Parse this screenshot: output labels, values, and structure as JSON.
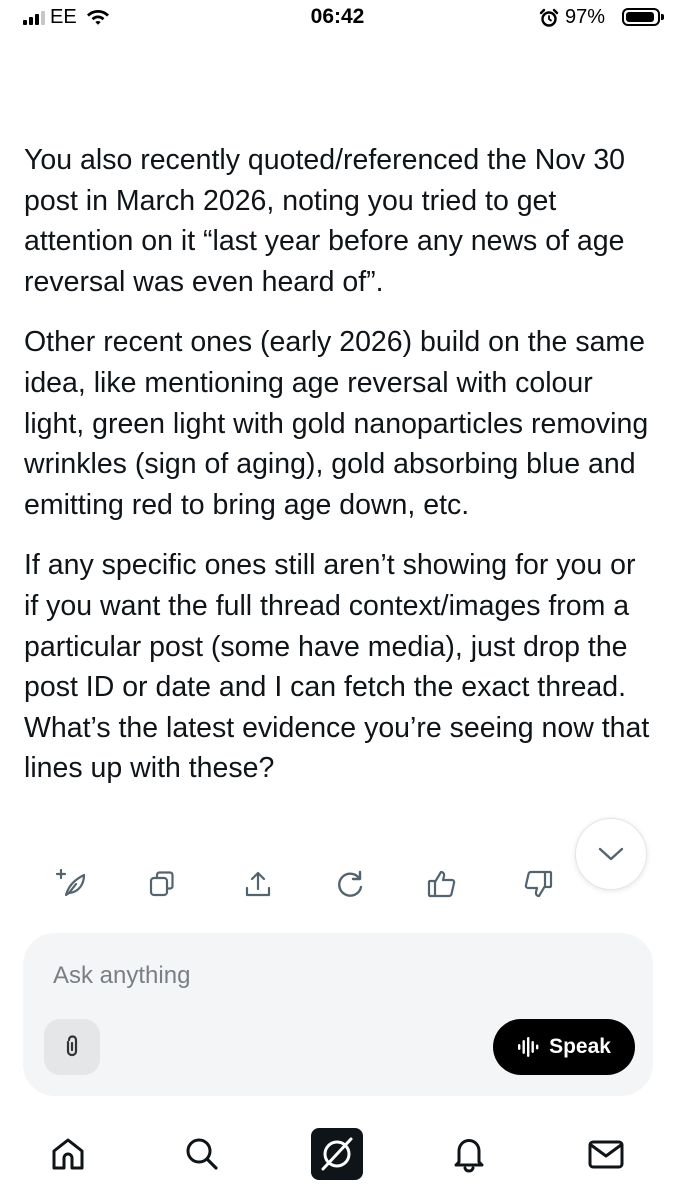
{
  "status_bar": {
    "carrier": "EE",
    "time": "06:42",
    "battery_percent": "97%",
    "signal_icon": "signal-icon",
    "wifi_icon": "wifi-icon",
    "alarm_icon": "alarm-icon",
    "battery_level": 0.97
  },
  "response": {
    "paragraphs": [
      "You also recently quoted/referenced the Nov 30 post in March 2026, noting you tried to get attention on it “last year before any news of age reversal was even heard of”.",
      "Other recent ones (early 2026) build on the same idea, like mentioning age reversal with colour light, green light with gold nanoparticles removing wrinkles (sign of aging), gold absorbing blue and emitting red to bring age down, etc.",
      "If any specific ones still aren’t showing for you or if you want the full thread context/images from a particular post (some have media), just drop the post ID or date and I can fetch the exact thread. What’s the latest evidence you’re seeing now that lines up with these?"
    ]
  },
  "actions": {
    "icons": [
      "compose-icon",
      "copy-icon",
      "share-icon",
      "regenerate-icon",
      "thumbs-up-icon",
      "thumbs-down-icon"
    ]
  },
  "scroll_down_icon": "chevron-down-icon",
  "composer": {
    "placeholder": "Ask anything",
    "value": "",
    "attach_icon": "paperclip-icon",
    "speak_label": "Speak",
    "speak_icon": "waveform-icon"
  },
  "tab_bar": {
    "tabs": [
      "home-icon",
      "search-icon",
      "grok-icon",
      "bell-icon",
      "mail-icon"
    ],
    "active": "grok-icon"
  },
  "colors": {
    "text": "#0f1419",
    "icon": "#536471",
    "composer_bg": "#f4f5f6",
    "speak_bg": "#000000"
  }
}
